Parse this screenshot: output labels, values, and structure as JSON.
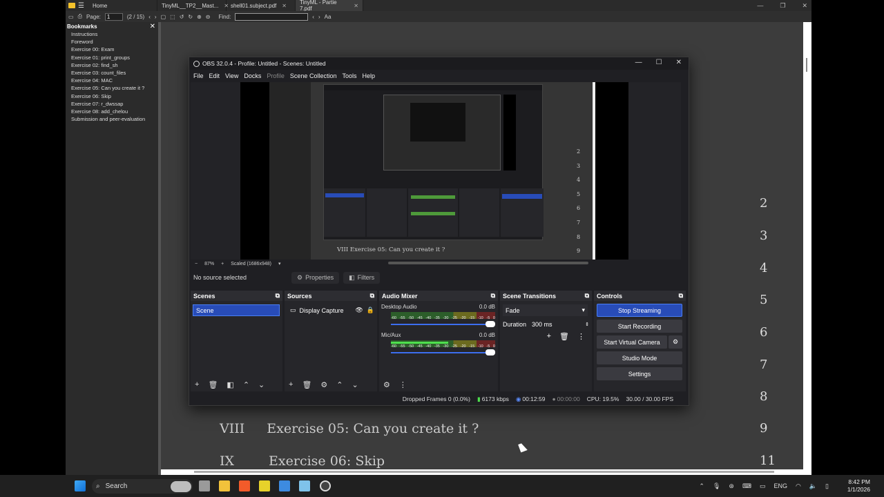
{
  "pdf": {
    "tabs": [
      {
        "label": "Home"
      },
      {
        "label": "TinyML__TP2__Mast..."
      },
      {
        "label": "shell01.subject.pdf"
      },
      {
        "label": "TinyML - Partie 7.pdf"
      }
    ],
    "page_label": "Page:",
    "page_value": "1",
    "page_total": "(2 / 15)",
    "find_label": "Find:",
    "bookmarks_title": "Bookmarks",
    "bookmarks": [
      "Instructions",
      "Foreword",
      "Exercise 00: Exam",
      "Exercise 01: print_groups",
      "Exercise 02: find_sh",
      "Exercise 03: count_files",
      "Exercise 04: MAC",
      "Exercise 05: Can you create it ?",
      "Exercise 06: Skip",
      "Exercise 07: r_dwssap",
      "Exercise 08: add_chelou",
      "Submission and peer-evaluation"
    ],
    "page_numbers": [
      "2",
      "3",
      "4",
      "5",
      "6",
      "7",
      "8",
      "9",
      "11"
    ],
    "toc": [
      {
        "num": "VIII",
        "title": "Exercise 05:  Can you create it ?"
      },
      {
        "num": "IX",
        "title": "Exercise 06:  Skip"
      }
    ]
  },
  "obs": {
    "title": "OBS 32.0.4 - Profile: Untitled - Scenes: Untitled",
    "menu": [
      "File",
      "Edit",
      "View",
      "Docks",
      "Profile",
      "Scene Collection",
      "Tools",
      "Help"
    ],
    "zoom": "87%",
    "scaled": "Scaled (1686x948)",
    "no_source": "No source selected",
    "properties": "Properties",
    "filters": "Filters",
    "scenes_title": "Scenes",
    "scene_name": "Scene",
    "sources_title": "Sources",
    "source_name": "Display Capture",
    "mixer_title": "Audio Mixer",
    "channels": [
      {
        "name": "Desktop Audio",
        "db": "0.0 dB",
        "level": 0.0
      },
      {
        "name": "Mic/Aux",
        "db": "0.0 dB",
        "level": 0.55
      }
    ],
    "meter_ticks": [
      "-60",
      "-55",
      "-50",
      "-45",
      "-40",
      "-35",
      "-30",
      "-25",
      "-20",
      "-15",
      "-10",
      "-5",
      "0"
    ],
    "transitions_title": "Scene Transitions",
    "transition": "Fade",
    "duration_label": "Duration",
    "duration": "300 ms",
    "controls_title": "Controls",
    "controls": [
      "Stop Streaming",
      "Start Recording",
      "Start Virtual Camera",
      "Studio Mode",
      "Settings"
    ],
    "status": {
      "dropped": "Dropped Frames 0 (0.0%)",
      "bitrate": "6173 kbps",
      "stream_time": "00:12:59",
      "rec_time": "00:00:00",
      "cpu": "CPU: 19.5%",
      "fps": "30.00 / 30.00 FPS"
    },
    "nested_text": "VIII   Exercise 05:  Can you create it ?",
    "nested_nums": [
      "2",
      "3",
      "4",
      "5",
      "6",
      "7",
      "8",
      "9"
    ]
  },
  "taskbar": {
    "search": "Search",
    "lang": "ENG",
    "time": "8:42 PM",
    "date": "1/1/2026"
  }
}
